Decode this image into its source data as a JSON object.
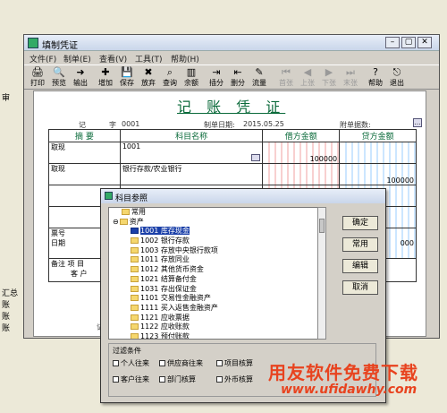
{
  "window": {
    "title": "填制凭证"
  },
  "menu": [
    "文件(F)",
    "制单(E)",
    "查看(V)",
    "工具(T)",
    "帮助(H)"
  ],
  "toolbar": [
    {
      "label": "打印",
      "icon": "printer-icon",
      "glyph": "🖨",
      "enabled": true
    },
    {
      "label": "预览",
      "icon": "preview-icon",
      "glyph": "🔍",
      "enabled": true
    },
    {
      "label": "输出",
      "icon": "export-icon",
      "glyph": "➜",
      "enabled": true
    },
    {
      "label": "增加",
      "icon": "add-icon",
      "glyph": "✚",
      "enabled": true
    },
    {
      "label": "保存",
      "icon": "save-icon",
      "glyph": "💾",
      "enabled": true
    },
    {
      "label": "放弃",
      "icon": "discard-icon",
      "glyph": "✖",
      "enabled": true
    },
    {
      "label": "查询",
      "icon": "query-icon",
      "glyph": "⌕",
      "enabled": true
    },
    {
      "label": "余额",
      "icon": "balance-icon",
      "glyph": "▥",
      "enabled": true
    },
    {
      "label": "插分",
      "icon": "insert-row-icon",
      "glyph": "⇥",
      "enabled": true
    },
    {
      "label": "删分",
      "icon": "delete-row-icon",
      "glyph": "⇤",
      "enabled": true
    },
    {
      "label": "流量",
      "icon": "flow-icon",
      "glyph": "✎",
      "enabled": true
    },
    {
      "label": "首张",
      "icon": "first-icon",
      "glyph": "⏮",
      "enabled": false
    },
    {
      "label": "上张",
      "icon": "prev-icon",
      "glyph": "◀",
      "enabled": false
    },
    {
      "label": "下张",
      "icon": "next-icon",
      "glyph": "▶",
      "enabled": false
    },
    {
      "label": "末张",
      "icon": "last-icon",
      "glyph": "⏭",
      "enabled": false
    },
    {
      "label": "帮助",
      "icon": "help-icon",
      "glyph": "?",
      "enabled": true
    },
    {
      "label": "退出",
      "icon": "exit-icon",
      "glyph": "⎋",
      "enabled": true
    }
  ],
  "voucher": {
    "title": "记 账 凭 证",
    "type_label": "记",
    "no_label": "字",
    "no_value": "0001",
    "date_label": "制单日期:",
    "date_value": "2015.05.25",
    "attach_label": "附单据数:",
    "headers": {
      "summary": "摘 要",
      "account": "科目名称",
      "debit": "借方金额",
      "credit": "贷方金额"
    },
    "rows": [
      {
        "summary": "取现",
        "account": "1001",
        "debit": "100000",
        "credit": ""
      },
      {
        "summary": "取现",
        "account": "银行存款/农业银行",
        "debit": "",
        "credit": "100000"
      }
    ],
    "ticket_label": "票号",
    "date2_label": "日期",
    "remark_label": "备注",
    "project_label": "项  目",
    "customer_label": "客  户",
    "bookkeeper_label": "记账",
    "credit_partial": "000"
  },
  "background_text": [
    "审",
    "汇总",
    "账",
    "账",
    "账"
  ],
  "dialog": {
    "title": "科目参照",
    "tree": [
      {
        "label": "常用",
        "indent": 1,
        "selected": false
      },
      {
        "label": "资产",
        "indent": 0,
        "selected": false
      },
      {
        "label": "1001 库存现金",
        "indent": 2,
        "selected": true
      },
      {
        "label": "1002 银行存款",
        "indent": 2,
        "selected": false
      },
      {
        "label": "1003 存放中央银行款项",
        "indent": 2,
        "selected": false
      },
      {
        "label": "1011 存放同业",
        "indent": 2,
        "selected": false
      },
      {
        "label": "1012 其他货币资金",
        "indent": 2,
        "selected": false
      },
      {
        "label": "1021 结算备付金",
        "indent": 2,
        "selected": false
      },
      {
        "label": "1031 存出保证金",
        "indent": 2,
        "selected": false
      },
      {
        "label": "1101 交易性金融资产",
        "indent": 2,
        "selected": false
      },
      {
        "label": "1111 买入返售金融资产",
        "indent": 2,
        "selected": false
      },
      {
        "label": "1121 应收票据",
        "indent": 2,
        "selected": false
      },
      {
        "label": "1122 应收账款",
        "indent": 2,
        "selected": false
      },
      {
        "label": "1123 预付账款",
        "indent": 2,
        "selected": false
      },
      {
        "label": "1131 应收股利",
        "indent": 2,
        "selected": false
      }
    ],
    "buttons": {
      "ok": "确定",
      "common": "常用",
      "edit": "编辑",
      "cancel": "取消"
    },
    "filter_label": "过滤条件",
    "filters_row1": [
      "个人往来",
      "供应商往来",
      "项目核算"
    ],
    "filters_row2": [
      "客户往来",
      "部门核算",
      "外币核算"
    ]
  },
  "watermark": {
    "line1": "用友软件免费下载",
    "line2": "www.ufidawhy.com"
  }
}
